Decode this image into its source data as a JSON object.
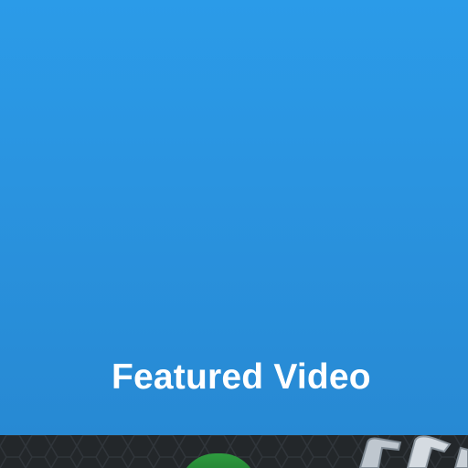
{
  "hero": {
    "title": "Featured Video",
    "background_color": "#2a94e0",
    "text_color": "#ffffff"
  },
  "video_thumbnail": {
    "background_color": "#23272a",
    "pattern": "hexagon-pattern",
    "accent_color": "#2e9b3f"
  }
}
